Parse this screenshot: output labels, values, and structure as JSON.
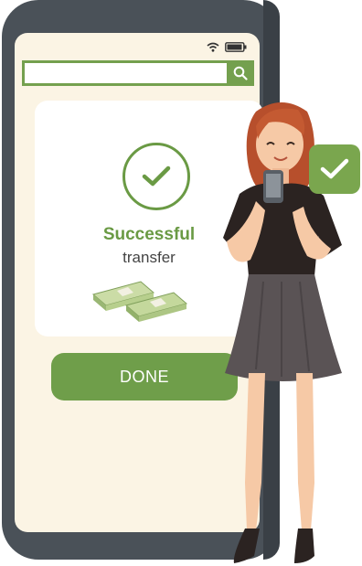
{
  "search": {
    "placeholder": ""
  },
  "card": {
    "title": "Successful",
    "subtitle": "transfer"
  },
  "done_button": {
    "label": "DONE"
  },
  "icons": {
    "status": [
      "wifi-icon",
      "battery-icon"
    ],
    "search": "search-icon",
    "success": "checkmark-circle-icon",
    "money": "money-stack-icon",
    "badge": "checkmark-badge-icon"
  },
  "colors": {
    "accent_green": "#6f9e4a",
    "screen_bg": "#fbf4e4",
    "phone_frame": "#4a5158"
  }
}
